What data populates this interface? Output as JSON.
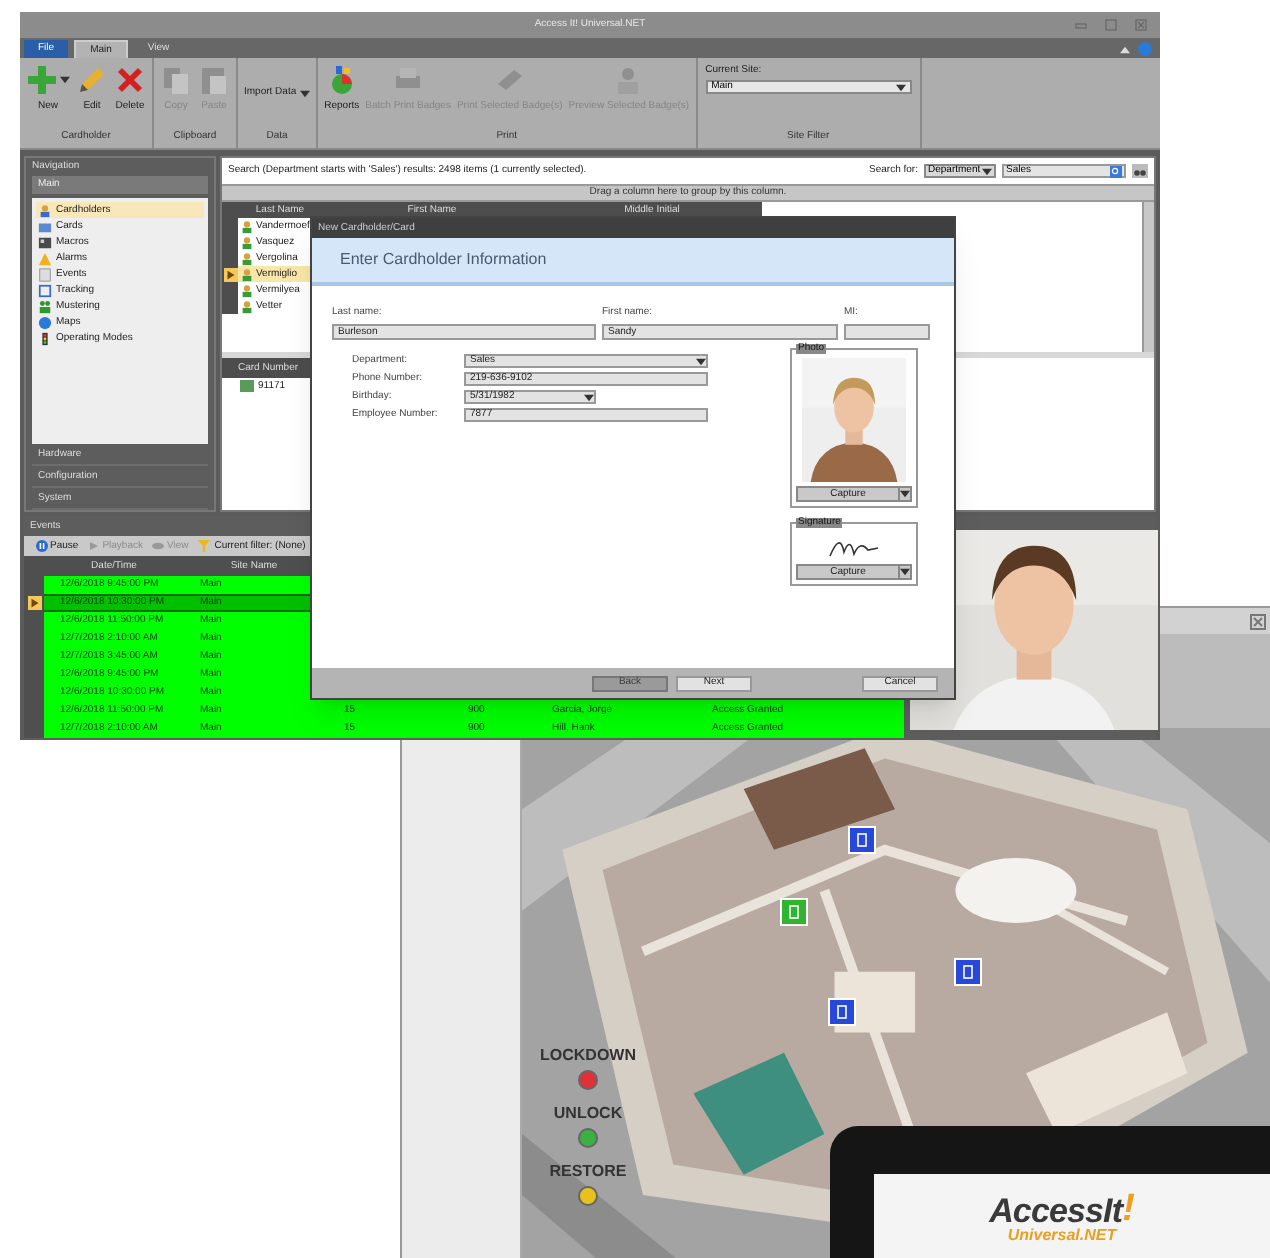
{
  "main_window": {
    "title": "Access It! Universal.NET",
    "ribbon_tabs": [
      {
        "label": "File",
        "kind": "file",
        "selected": false
      },
      {
        "label": "Main",
        "kind": "tab",
        "selected": true
      },
      {
        "label": "View",
        "kind": "tab",
        "selected": false
      }
    ],
    "ribbon_groups": [
      {
        "label": "Cardholder",
        "buttons": [
          {
            "label": "New",
            "disabled": false,
            "dropdown": true
          },
          {
            "label": "Edit",
            "disabled": false,
            "dropdown": false
          },
          {
            "label": "Delete",
            "disabled": false,
            "dropdown": false
          }
        ]
      },
      {
        "label": "Clipboard",
        "buttons": [
          {
            "label": "Copy",
            "disabled": true,
            "dropdown": false
          },
          {
            "label": "Paste",
            "disabled": true,
            "dropdown": false
          }
        ]
      },
      {
        "label": "Data",
        "buttons": [
          {
            "label": "Import Data",
            "disabled": false,
            "dropdown": true
          }
        ]
      },
      {
        "label": "Print",
        "buttons": [
          {
            "label": "Reports",
            "disabled": false,
            "dropdown": false
          },
          {
            "label": "Batch Print Badges",
            "disabled": true,
            "dropdown": false
          },
          {
            "label": "Print Selected Badge(s)",
            "disabled": true,
            "dropdown": false
          },
          {
            "label": "Preview Selected Badge(s)",
            "disabled": true,
            "dropdown": false
          }
        ]
      }
    ],
    "site_filter": {
      "label": "Current Site:",
      "value": "Main",
      "group": "Site Filter"
    },
    "navigation": {
      "title": "Navigation",
      "section": "Main",
      "items": [
        {
          "label": "Cardholders",
          "selected": true
        },
        {
          "label": "Cards",
          "selected": false
        },
        {
          "label": "Macros",
          "selected": false
        },
        {
          "label": "Alarms",
          "selected": false
        },
        {
          "label": "Events",
          "selected": false
        },
        {
          "label": "Tracking",
          "selected": false
        },
        {
          "label": "Mustering",
          "selected": false
        },
        {
          "label": "Maps",
          "selected": false
        },
        {
          "label": "Operating Modes",
          "selected": false
        }
      ],
      "sections": [
        "Hardware",
        "Configuration",
        "System"
      ]
    },
    "search": {
      "summary": "Search (Department starts with 'Sales') results: 2498 items (1 currently selected).",
      "label": "Search for:",
      "field": "Department",
      "value": "Sales"
    },
    "group_hint": "Drag a column here to group by this column.",
    "columns": [
      "Last Name",
      "First Name",
      "Middle Initial"
    ],
    "rows": [
      {
        "last_name": "Vandermoef",
        "selected": false
      },
      {
        "last_name": "Vasquez",
        "selected": false
      },
      {
        "last_name": "Vergolina",
        "selected": false
      },
      {
        "last_name": "Vermiglio",
        "selected": true
      },
      {
        "last_name": "Vermilyea",
        "selected": false
      },
      {
        "last_name": "Vetter",
        "selected": false
      }
    ],
    "card_table": {
      "column": "Card Number",
      "rows": [
        "91171"
      ]
    },
    "events": {
      "title": "Events",
      "toolbar": [
        {
          "label": "Pause",
          "disabled": false
        },
        {
          "label": "Playback",
          "disabled": true
        },
        {
          "label": "View",
          "disabled": true
        }
      ],
      "filter": {
        "label": "Current filter:",
        "value": "(None)"
      },
      "columns": [
        "Date/Time",
        "Site Name"
      ],
      "rows": [
        {
          "selected": false,
          "cells": [
            "12/6/2018 9:45:00 PM",
            "Main"
          ]
        },
        {
          "selected": true,
          "cells": [
            "12/6/2018 10:30:00 PM",
            "Main"
          ]
        },
        {
          "selected": false,
          "cells": [
            "12/6/2018 11:50:00 PM",
            "Main"
          ]
        },
        {
          "selected": false,
          "cells": [
            "12/7/2018 2:10:00 AM",
            "Main"
          ]
        },
        {
          "selected": false,
          "cells": [
            "12/7/2018 3:45:00 AM",
            "Main"
          ]
        },
        {
          "selected": false,
          "cells": [
            "12/6/2018 9:45:00 PM",
            "Main"
          ]
        },
        {
          "selected": false,
          "cells": [
            "12/6/2018 10:30:00 PM",
            "Main"
          ]
        },
        {
          "selected": false,
          "cells": [
            "12/6/2018 11:50:00 PM",
            "Main",
            "15",
            "900",
            "Garcia, Jorge",
            "Access Granted"
          ]
        },
        {
          "selected": false,
          "cells": [
            "12/7/2018 2:10:00 AM",
            "Main",
            "15",
            "900",
            "Hill, Hank",
            "Access Granted"
          ]
        }
      ]
    }
  },
  "dialog": {
    "title": "New Cardholder/Card",
    "heading": "Enter Cardholder Information",
    "name_fields": [
      {
        "label": "Last name:",
        "value": "Burleson"
      },
      {
        "label": "First name:",
        "value": "Sandy"
      },
      {
        "label": "MI:"
      }
    ],
    "details": [
      {
        "label": "Department:",
        "value": "Sales",
        "kind": "select"
      },
      {
        "label": "Phone Number:",
        "value": "219-636-9102",
        "kind": "text"
      },
      {
        "label": "Birthday:",
        "value": "5/31/1982",
        "kind": "select"
      },
      {
        "label": "Employee Number:",
        "value": "7877",
        "kind": "text"
      }
    ],
    "photo": {
      "legend": "Photo",
      "button": "Capture"
    },
    "signature": {
      "legend": "Signature",
      "button": "Capture"
    },
    "buttons": [
      {
        "label": "Back",
        "disabled": true
      },
      {
        "label": "Next",
        "disabled": false
      },
      {
        "label": "Cancel",
        "disabled": false
      }
    ]
  },
  "map": {
    "controls": [
      {
        "label": "LOCKDOWN",
        "color": "#e0303a"
      },
      {
        "label": "UNLOCK",
        "color": "#3cb043"
      },
      {
        "label": "RESTORE",
        "color": "#e8c21c"
      }
    ],
    "doors": [
      {
        "color": "#2748d8"
      },
      {
        "color": "#2fb52f"
      },
      {
        "color": "#2748d8"
      },
      {
        "color": "#2748d8"
      }
    ]
  },
  "logo": {
    "name": "AccessIt",
    "mark": "!",
    "tagline": "Universal.NET"
  }
}
